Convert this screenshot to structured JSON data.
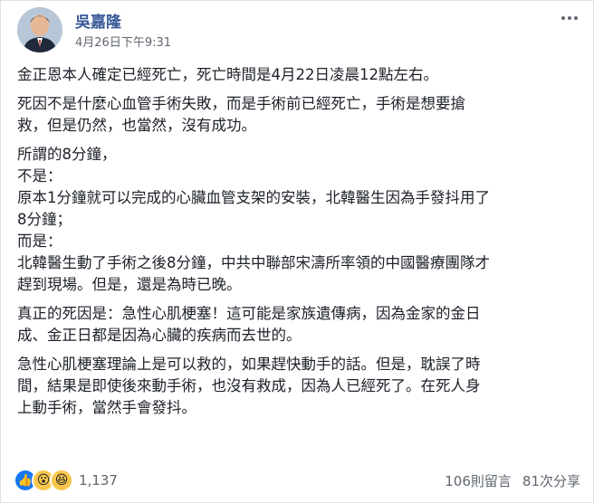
{
  "post": {
    "author": "吳嘉隆",
    "time": "4月26日下午9:31",
    "menu_icon": "more-dots-icon",
    "lines": [
      [
        "金正恩本人確定已經死亡，死亡時間是4月22日凌晨12點左右。"
      ],
      [
        "死因不是什麼心血管手術失敗，而是手術前已經死亡，手術是想要搶",
        "救，但是仍然，也當然，沒有成功。"
      ],
      [
        "所謂的8分鐘，",
        " 不是：",
        "原本1分鐘就可以完成的心臟血管支架的安裝，北韓醫生因為手發抖用了",
        "8分鐘；",
        " 而是：",
        "北韓醫生動了手術之後8分鐘，中共中聯部宋濤所率領的中國醫療團隊才",
        "趕到現場。但是，還是為時已晚。"
      ],
      [
        "真正的死因是：急性心肌梗塞！這可能是家族遺傳病，因為金家的金日",
        "成、金正日都是因為心臟的疾病而去世的。"
      ],
      [
        "急性心肌梗塞理論上是可以救的，如果趕快動手的話。但是，耽誤了時",
        "間，結果是即使後來動手術，也沒有救成，因為人已經死了。在死人身",
        "上動手術，當然手會發抖。"
      ]
    ]
  },
  "footer": {
    "reactions": [
      "like-icon",
      "wow-icon",
      "haha-icon"
    ],
    "reaction_count": "1,137",
    "comments": "106則留言",
    "shares": "81次分享"
  },
  "colors": {
    "author_link": "#385898",
    "meta_text": "#616770",
    "body_text": "#1d2129",
    "like_blue": "#1877f2",
    "emoji_yellow": "#f7c64a"
  }
}
